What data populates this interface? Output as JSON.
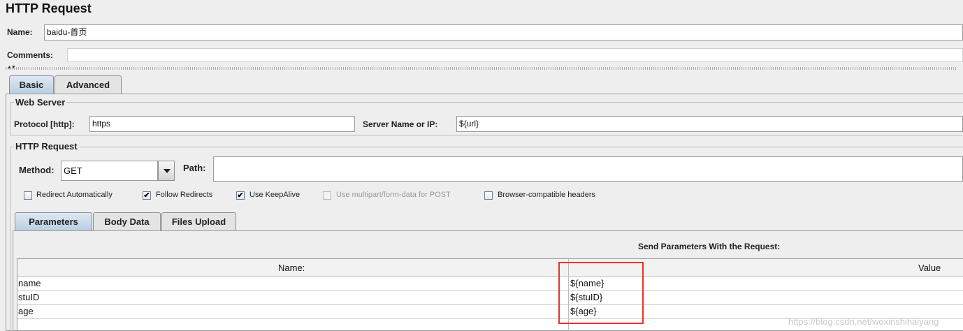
{
  "header": {
    "title": "HTTP Request"
  },
  "name_field": {
    "label": "Name:",
    "value": "baidu-首页"
  },
  "comments": {
    "label": "Comments:"
  },
  "tabs": [
    {
      "label": "Basic"
    },
    {
      "label": "Advanced"
    }
  ],
  "web_server": {
    "title": "Web Server",
    "protocol_label": "Protocol [http]:",
    "protocol_value": "https",
    "server_label": "Server Name or IP:",
    "server_value": "${url}"
  },
  "http_request": {
    "title": "HTTP Request",
    "method_label": "Method:",
    "method_value": "GET",
    "path_label": "Path:",
    "path_value": ""
  },
  "options": [
    {
      "label": "Redirect Automatically",
      "checked": false,
      "enabled": true
    },
    {
      "label": "Follow Redirects",
      "checked": true,
      "enabled": true
    },
    {
      "label": "Use KeepAlive",
      "checked": true,
      "enabled": true
    },
    {
      "label": "Use multipart/form-data for POST",
      "checked": false,
      "enabled": false
    },
    {
      "label": "Browser-compatible headers",
      "checked": false,
      "enabled": true
    }
  ],
  "param_tabs": [
    {
      "label": "Parameters"
    },
    {
      "label": "Body Data"
    },
    {
      "label": "Files Upload"
    }
  ],
  "params_table": {
    "title": "Send Parameters With the Request:",
    "columns": [
      "Name:",
      "Value"
    ],
    "rows": [
      {
        "name": "name",
        "value": "${name}"
      },
      {
        "name": "stuID",
        "value": "${stuID}"
      },
      {
        "name": "age",
        "value": "${age}"
      }
    ]
  },
  "colors": {
    "highlight": "#e8322c",
    "selected_tab": "#b8cde2"
  },
  "watermark": "https://blog.csdn.net/woxinshihaiyang"
}
